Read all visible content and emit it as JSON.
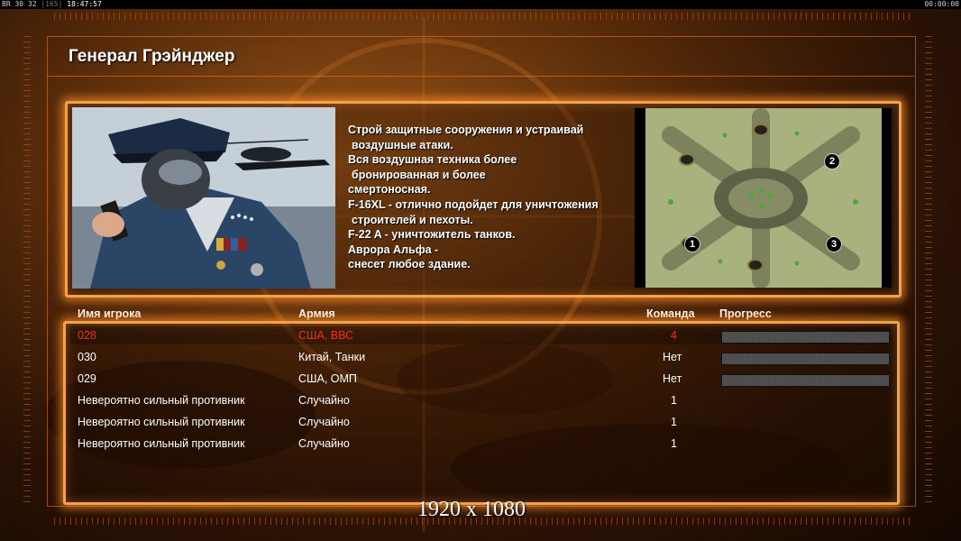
{
  "statusbar": {
    "left_text": "BR 30 32",
    "left_dim": "|165|",
    "time": "18:47:57",
    "right_text": "00:00:00"
  },
  "general": {
    "name": "Генерал Грэйнджер",
    "description": [
      "Строй защитные сооружения и устраивай",
      "воздушные атаки.",
      "Вся воздушная техника более",
      "бронированная и более",
      "смертоносная.",
      "F-16XL - отлично подойдет для уничтожения",
      "строителей и пехоты.",
      "F-22 A - уничтожитель танков.",
      "Аврора Альфа -",
      "снесет любое здание."
    ]
  },
  "minimap": {
    "start_positions": [
      "1",
      "2",
      "3"
    ]
  },
  "table": {
    "headers": {
      "player": "Имя игрока",
      "army": "Армия",
      "team": "Команда",
      "progress": "Прогресс"
    },
    "rows": [
      {
        "player": "028",
        "army": "США, ВВС",
        "team": "4",
        "progress": 0,
        "is_local": true
      },
      {
        "player": "030",
        "army": "Китай, Танки",
        "team": "Нет",
        "progress": 0,
        "is_local": false
      },
      {
        "player": "029",
        "army": "США, ОМП",
        "team": "Нет",
        "progress": 0,
        "is_local": false
      },
      {
        "player": "Невероятно сильный противник",
        "army": "Случайно",
        "team": "1",
        "progress": null,
        "is_local": false
      },
      {
        "player": "Невероятно сильный противник",
        "army": "Случайно",
        "team": "1",
        "progress": null,
        "is_local": false
      },
      {
        "player": "Невероятно сильный противник",
        "army": "Случайно",
        "team": "1",
        "progress": null,
        "is_local": false
      }
    ]
  },
  "resolution_label": "1920 x 1080",
  "colors": {
    "panel_border": "#f2a24a",
    "local_player": "#ff2a1a",
    "background": "#5a2a08"
  }
}
